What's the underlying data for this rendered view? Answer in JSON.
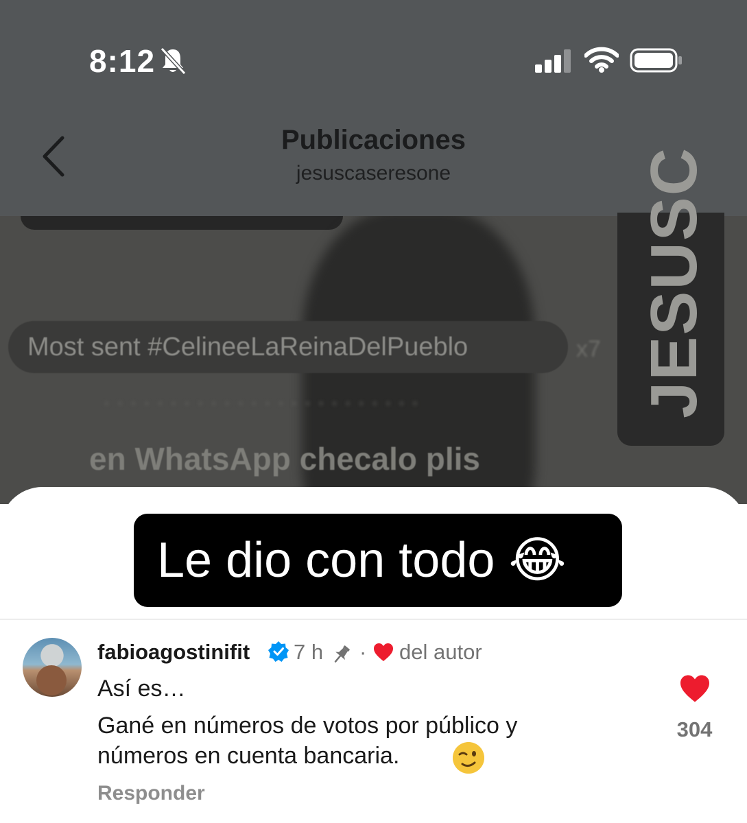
{
  "status_bar": {
    "time": "8:12",
    "icons": [
      "bell-slash-icon",
      "cellular-signal-icon",
      "wifi-icon",
      "battery-icon"
    ]
  },
  "header": {
    "title": "Publicaciones",
    "subtitle": "jesuscaseresone",
    "back_icon": "chevron-left-icon"
  },
  "post": {
    "sticker_text": "Most sent #CelineeLaReinaDelPueblo",
    "overlay_text": "en WhatsApp checalo plis",
    "watermark": "JESUSC",
    "caption": "Le dio con todo 😂"
  },
  "comment": {
    "username": "fabioagostinifit",
    "verified": true,
    "time": "7 h",
    "pinned": true,
    "author_like_label": "del autor",
    "text_line1": "Así es…",
    "text_line2": "Gané en números de votos por público y",
    "text_line3": "números en cuenta bancaria.",
    "likes": "304",
    "reply_label": "Responder"
  },
  "colors": {
    "dim_overlay": "#535658",
    "like_red": "#ed1c2e",
    "verified_blue": "#0095f6",
    "secondary_text": "#737373"
  }
}
